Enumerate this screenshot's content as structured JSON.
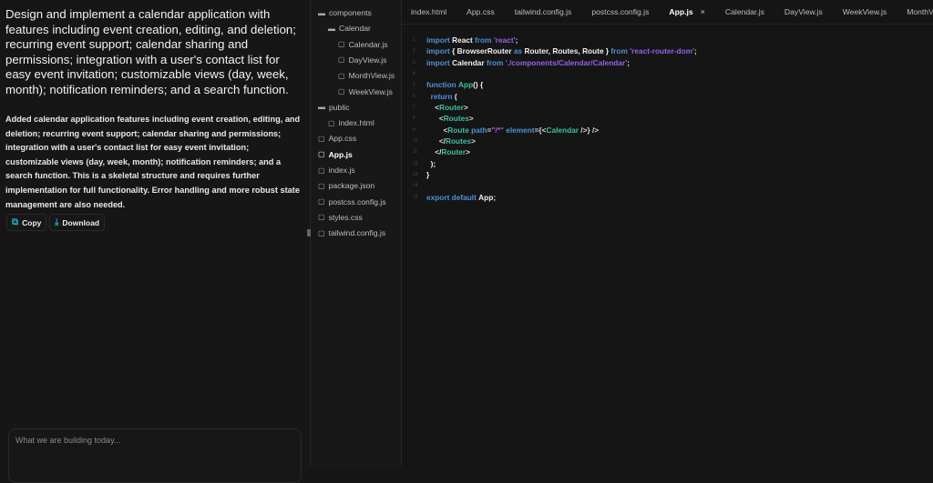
{
  "chat": {
    "heading": "Design and implement a calendar application with features including event creation, editing, and deletion; recurring event support; calendar sharing and permissions; integration with a user's contact list for easy event invitation; customizable views (day, week, month); notification reminders; and a search function.",
    "response": "Added calendar application features including event creation, editing, and deletion; recurring event support; calendar sharing and permissions; integration with a user's contact list for easy event invitation; customizable views (day, week, month); notification reminders; and a search function. This is a skeletal structure and requires further implementation for full functionality. Error handling and more robust state management are also needed.",
    "copy_label": "Copy",
    "download_label": "Download",
    "prompt_placeholder": "What we are building today..."
  },
  "tree": [
    {
      "label": "components",
      "type": "folder",
      "depth": 0
    },
    {
      "label": "Calendar",
      "type": "folder",
      "depth": 1
    },
    {
      "label": "Calendar.js",
      "type": "file",
      "depth": 2
    },
    {
      "label": "DayView.js",
      "type": "file",
      "depth": 2
    },
    {
      "label": "MonthView.js",
      "type": "file",
      "depth": 2
    },
    {
      "label": "WeekView.js",
      "type": "file",
      "depth": 2
    },
    {
      "label": "public",
      "type": "folder",
      "depth": 0
    },
    {
      "label": "index.html",
      "type": "file",
      "depth": 1
    },
    {
      "label": "App.css",
      "type": "file",
      "depth": 0
    },
    {
      "label": "App.js",
      "type": "file",
      "depth": 0,
      "active": true
    },
    {
      "label": "index.js",
      "type": "file",
      "depth": 0
    },
    {
      "label": "package.json",
      "type": "file",
      "depth": 0
    },
    {
      "label": "postcss.config.js",
      "type": "file",
      "depth": 0
    },
    {
      "label": "styles.css",
      "type": "file",
      "depth": 0
    },
    {
      "label": "tailwind.config.js",
      "type": "file",
      "depth": 0
    }
  ],
  "tabs": [
    {
      "label": "index.html"
    },
    {
      "label": "App.css"
    },
    {
      "label": "tailwind.config.js"
    },
    {
      "label": "postcss.config.js"
    },
    {
      "label": "App.js",
      "active": true,
      "close": "×"
    },
    {
      "label": "Calendar.js"
    },
    {
      "label": "DayView.js"
    },
    {
      "label": "WeekView.js"
    },
    {
      "label": "MonthView.js"
    }
  ],
  "code": [
    [
      [
        "import ",
        "k"
      ],
      [
        "React ",
        "i"
      ],
      [
        "from ",
        "k"
      ],
      [
        "'react'",
        "s"
      ],
      [
        ";",
        "p"
      ]
    ],
    [
      [
        "import ",
        "k"
      ],
      [
        "{ BrowserRouter ",
        "i"
      ],
      [
        "as ",
        "k"
      ],
      [
        "Router, Routes, Route } ",
        "i"
      ],
      [
        "from ",
        "k"
      ],
      [
        "'react-router-dom'",
        "s"
      ],
      [
        ";",
        "p"
      ]
    ],
    [
      [
        "import ",
        "k"
      ],
      [
        "Calendar ",
        "i"
      ],
      [
        "from ",
        "k"
      ],
      [
        "'./components/Calendar/Calendar'",
        "s"
      ],
      [
        ";",
        "p"
      ]
    ],
    [],
    [
      [
        "function ",
        "k"
      ],
      [
        "App",
        "t"
      ],
      [
        "() {",
        "i"
      ]
    ],
    [
      [
        "  return ",
        "k"
      ],
      [
        "(",
        "i"
      ]
    ],
    [
      [
        "    <",
        "p"
      ],
      [
        "Router",
        "t"
      ],
      [
        ">",
        "p"
      ]
    ],
    [
      [
        "      <",
        "p"
      ],
      [
        "Routes",
        "t"
      ],
      [
        ">",
        "p"
      ]
    ],
    [
      [
        "        <",
        "p"
      ],
      [
        "Route ",
        "t"
      ],
      [
        "path",
        "k"
      ],
      [
        "=",
        "p"
      ],
      [
        "\"/*\" ",
        "s"
      ],
      [
        "element",
        "k"
      ],
      [
        "={<",
        "p"
      ],
      [
        "Calendar ",
        "t"
      ],
      [
        "/>} />",
        "p"
      ]
    ],
    [
      [
        "      </",
        "p"
      ],
      [
        "Routes",
        "t"
      ],
      [
        ">",
        "p"
      ]
    ],
    [
      [
        "    </",
        "p"
      ],
      [
        "Router",
        "t"
      ],
      [
        ">",
        "p"
      ]
    ],
    [
      [
        "  );",
        "i"
      ]
    ],
    [
      [
        "}",
        "i"
      ]
    ],
    [],
    [
      [
        "export default ",
        "k"
      ],
      [
        "App",
        "i"
      ],
      [
        ";",
        "p"
      ]
    ]
  ]
}
